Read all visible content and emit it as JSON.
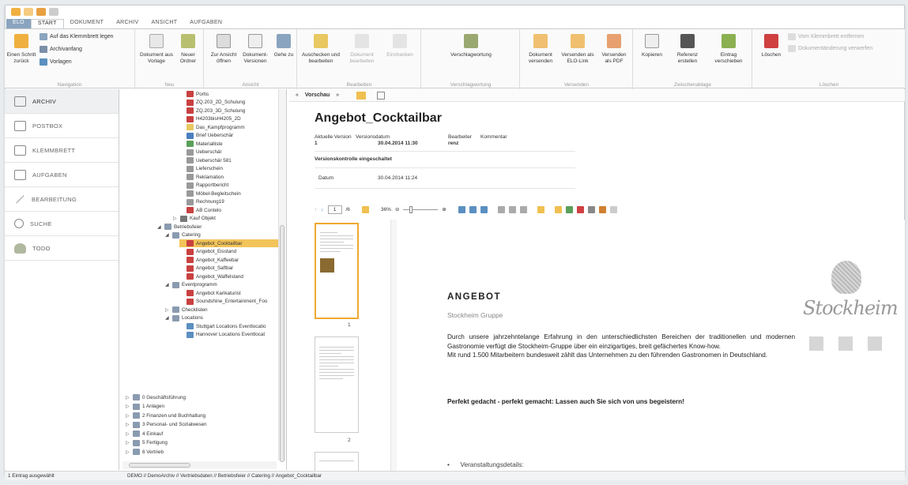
{
  "menu": {
    "tabs": [
      "ELO",
      "START",
      "DOKUMENT",
      "ARCHIV",
      "ANSICHT",
      "AUFGABEN"
    ]
  },
  "ribbon": {
    "navigation": {
      "back": "Einen Schritt zurück",
      "clipboard": "Auf das Klemmbrett legen",
      "archive_start": "Archivanfang",
      "templates": "Vorlagen",
      "label": "Navigation"
    },
    "neu": {
      "doc_from_template": "Dokument aus Vorlage",
      "new_folder": "Neuer Ordner",
      "label": "Neu"
    },
    "ansicht": {
      "open_view": "Zur Ansicht öffnen",
      "doc_versions": "Dokument-Versionen",
      "goto": "Gehe zu",
      "label": "Ansicht"
    },
    "bearbeiten": {
      "checkout": "Auschecken und bearbeiten",
      "edit_doc": "Dokument bearbeiten",
      "checkin": "Einchecken",
      "label": "Bearbeiten"
    },
    "verschlagwortung": {
      "tagging": "Verschlagwortung",
      "label": "Verschlagwortung"
    },
    "versenden": {
      "send_doc": "Dokument versenden",
      "send_link": "Versenden als ELO-Link",
      "send_pdf": "Versenden als PDF",
      "label": "Versenden"
    },
    "zwischenablage": {
      "copy": "Kopieren",
      "ref_create": "Referenz erstellen",
      "move": "Eintrag verschieben",
      "label": "Zwischenablage"
    },
    "loeschen": {
      "delete": "Löschen",
      "remove_clip": "Vom Klemmbrett entfernen",
      "discard": "Dokumentänderung verwerfen",
      "label": "Löschen"
    }
  },
  "leftnav": [
    {
      "label": "ARCHIV"
    },
    {
      "label": "POSTBOX"
    },
    {
      "label": "KLEMMBRETT"
    },
    {
      "label": "AUFGABEN"
    },
    {
      "label": "BEARBEITUNG"
    },
    {
      "label": "SUCHE"
    },
    {
      "label": "TODO"
    }
  ],
  "tree": [
    {
      "label": "Portis",
      "color": "#c94040"
    },
    {
      "label": "ZQ.203_2D_Schulung",
      "color": "#c94040"
    },
    {
      "label": "ZQ.203_3D_Schulung",
      "color": "#c94040"
    },
    {
      "label": "H4203bisH4205_2D",
      "color": "#c94040"
    },
    {
      "label": "Das_Kampfprogramm",
      "color": "#e8c860"
    },
    {
      "label": "Brief Ueberschär",
      "color": "#4a7fc0"
    },
    {
      "label": "Materialliste",
      "color": "#5aa05a"
    },
    {
      "label": "Ueberschär",
      "color": "#999999"
    },
    {
      "label": "Ueberschär 581",
      "color": "#999999"
    },
    {
      "label": "Lieferschein",
      "color": "#999999"
    },
    {
      "label": "Reklamation",
      "color": "#999999"
    },
    {
      "label": "Rapportbericht",
      "color": "#999999"
    },
    {
      "label": "Möbel-Begleitschein",
      "color": "#999999"
    },
    {
      "label": "Rechnung19",
      "color": "#999999"
    },
    {
      "label": "AB Contelo",
      "color": "#c94040"
    },
    {
      "label": "Kauf Objekt",
      "color": "#777777"
    },
    {
      "label": "Betriebsfeier",
      "color": "#8a9bb0"
    },
    {
      "label": "Catering",
      "color": "#8a9bb0"
    },
    {
      "label": "Angebot_Cocktailbar",
      "color": "#c94040"
    },
    {
      "label": "Angebot_Eisstand",
      "color": "#c94040"
    },
    {
      "label": "Angebot_Kaffeebar",
      "color": "#c94040"
    },
    {
      "label": "Angebot_Saftbar",
      "color": "#c94040"
    },
    {
      "label": "Angebot_Waffelstand",
      "color": "#c94040"
    },
    {
      "label": "Eventprogramm",
      "color": "#8a9bb0"
    },
    {
      "label": "Angebot Karikaturist",
      "color": "#c94040"
    },
    {
      "label": "Soundshine_Entertainment_Foo",
      "color": "#c94040"
    },
    {
      "label": "Checklisten",
      "color": "#8a9bb0"
    },
    {
      "label": "Locations",
      "color": "#8a9bb0"
    },
    {
      "label": "Stuttgart Locations Eventlocatio",
      "color": "#5a8fc0"
    },
    {
      "label": "Hannover Locations Eventlocat",
      "color": "#5a8fc0"
    },
    {
      "label": "0 Geschäftsführung",
      "color": "#8a9bb0"
    },
    {
      "label": "1 Anlagen",
      "color": "#8a9bb0"
    },
    {
      "label": "2 Finanzen und Buchhaltung",
      "color": "#8a9bb0"
    },
    {
      "label": "3 Personal- und Sozialwesen",
      "color": "#8a9bb0"
    },
    {
      "label": "4 Einkauf",
      "color": "#8a9bb0"
    },
    {
      "label": "5 Fertigung",
      "color": "#8a9bb0"
    },
    {
      "label": "6 Vertrieb",
      "color": "#8a9bb0"
    }
  ],
  "preview": {
    "nav_label": "Vorschau",
    "title": "Angebot_Cocktailbar",
    "headers": {
      "version": "Aktuelle Version",
      "date": "Versionsdatum",
      "editor": "Bearbeiter",
      "comment": "Kommentar"
    },
    "values": {
      "version": "1",
      "date": "30.04.2014 11:30",
      "editor": "renz"
    },
    "version_control": "Versionskontrolle eingeschaltet",
    "datum_label": "Datum",
    "datum_value": "30.04.2014 11:24",
    "page_current": "1",
    "page_total": "/6",
    "zoom": "36%",
    "thumb_numbers": [
      "1",
      "2"
    ]
  },
  "document": {
    "heading": "ANGEBOT",
    "company": "Stockheim Gruppe",
    "paragraph": "Durch unsere jahrzehntelange Erfahrung in den unterschiedlichsten Bereichen der traditionellen und modernen Gastronomie verfügt die Stockheim-Gruppe über ein einzigartiges, breit gefächertes Know-how.\nMit rund 1.500 Mitarbeitern bundesweit zählt das Unternehmen zu den führenden Gastronomen in Deutschland.",
    "slogan": "Perfekt gedacht - perfekt gemacht: Lassen auch Sie sich von uns begeistern!",
    "bullet": "Veranstaltungsdetails:",
    "logo_word": "Stockheim"
  },
  "status": {
    "selection": "1 Eintrag ausgewählt",
    "path": "DEMO // DemoArchiv // Vertriebsdaten // Betriebsfeier // Catering // Angebot_Cocktailbar"
  },
  "colors": {
    "accent": "#f3c45a",
    "elo_tab": "#8aa4bf"
  }
}
